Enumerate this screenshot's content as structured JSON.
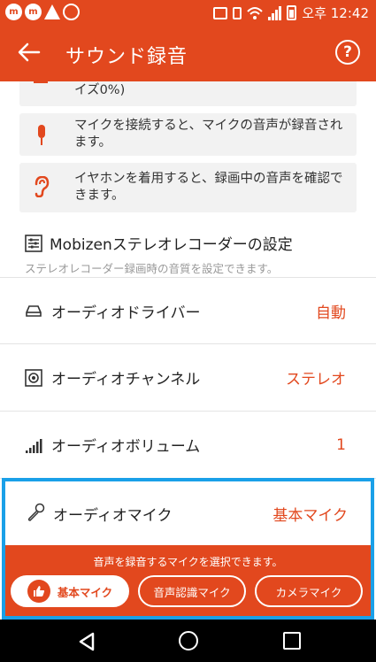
{
  "status_bar": {
    "app_icon_1": "m",
    "app_icon_2": "m",
    "time": "오후 12:42"
  },
  "app_bar": {
    "back_icon": "arrow-left-icon",
    "title": "サウンド録音",
    "help_label": "?"
  },
  "notes": [
    {
      "icon": "speaker-icon",
      "text": "イズ0%)"
    },
    {
      "icon": "microphone-icon",
      "text": "マイクを接続すると、マイクの音声が録音されます。"
    },
    {
      "icon": "ear-icon",
      "text": "イヤホンを着用すると、録画中の音声を確認できます。"
    }
  ],
  "stereo_section": {
    "title": "Mobizenステレオレコーダーの設定",
    "subtitle": "ステレオレコーダー録画時の音質を設定できます。"
  },
  "settings": [
    {
      "icon": "drive-icon",
      "label": "オーディオドライバー",
      "value": "自動"
    },
    {
      "icon": "speaker-channel-icon",
      "label": "オーディオチャンネル",
      "value": "ステレオ"
    },
    {
      "icon": "volume-bars-icon",
      "label": "オーディオボリューム",
      "value": "1"
    },
    {
      "icon": "microphone-line-icon",
      "label": "オーディオマイク",
      "value": "基本マイク"
    }
  ],
  "mic_panel": {
    "hint": "音声を録音するマイクを選択できます。",
    "options": [
      {
        "label": "基本マイク",
        "selected": true
      },
      {
        "label": "音声認識マイク",
        "selected": false
      },
      {
        "label": "カメラマイク",
        "selected": false
      }
    ]
  },
  "nav_bar": {
    "back": "nav-back-icon",
    "home": "nav-home-icon",
    "recent": "nav-recents-icon"
  },
  "colors": {
    "accent": "#e2481e",
    "highlight_border": "#1aa0e8",
    "nav_bar": "#000000"
  }
}
